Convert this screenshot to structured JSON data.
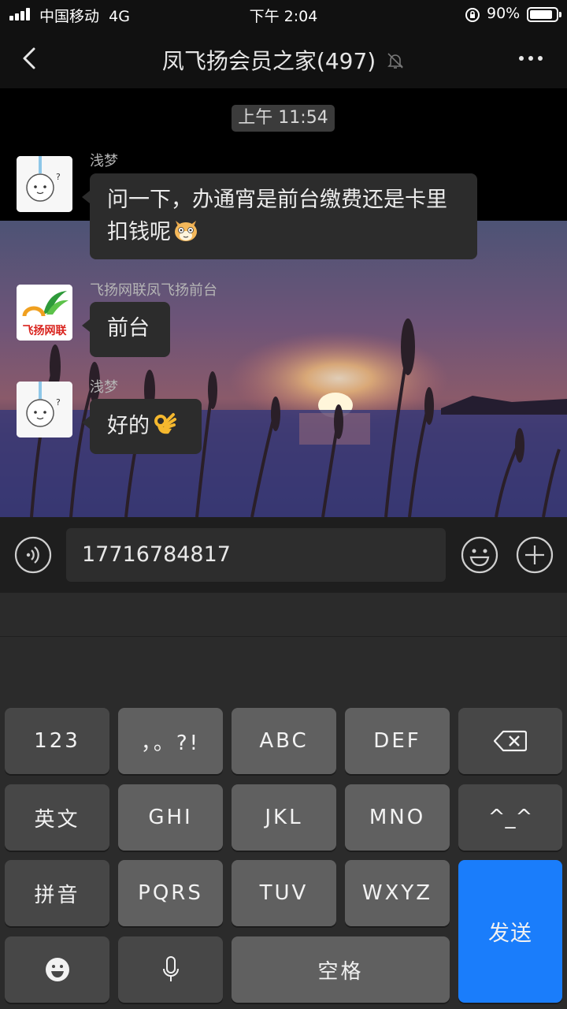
{
  "status_bar": {
    "carrier": "中国移动",
    "network": "4G",
    "time": "下午 2:04",
    "battery_pct": "90%",
    "battery_level": 0.9,
    "icons": [
      "signal-icon",
      "orientation-lock-icon",
      "battery-icon"
    ]
  },
  "nav": {
    "title": "凤飞扬会员之家(497)",
    "icons": [
      "back-icon",
      "muted-bell-icon",
      "more-icon"
    ]
  },
  "chat": {
    "timestamp": "上午 11:54",
    "messages": [
      {
        "sender": "浅梦",
        "text": "问一下，办通宵是前台缴费还是卡里扣钱呢",
        "emoji": "cat-face-icon"
      },
      {
        "sender": "飞扬网联凤飞扬前台",
        "text": "前台",
        "avatar_text": "飞扬网联"
      },
      {
        "sender": "浅梦",
        "text": "好的",
        "emoji": "ok-hand-icon"
      }
    ]
  },
  "input_bar": {
    "value": "17716784817",
    "icons": [
      "voice-icon",
      "emoji-icon",
      "plus-icon"
    ]
  },
  "keyboard": {
    "row1": [
      "123",
      "，。?!",
      "ABC",
      "DEF"
    ],
    "row2": [
      "英文",
      "GHI",
      "JKL",
      "MNO",
      "^_^"
    ],
    "row3": [
      "拼音",
      "PQRS",
      "TUV",
      "WXYZ"
    ],
    "send": "发送",
    "space": "空格",
    "icons": [
      "backspace-icon",
      "emoji-key-icon",
      "microphone-icon"
    ],
    "send_color": "#1a7dfb"
  }
}
